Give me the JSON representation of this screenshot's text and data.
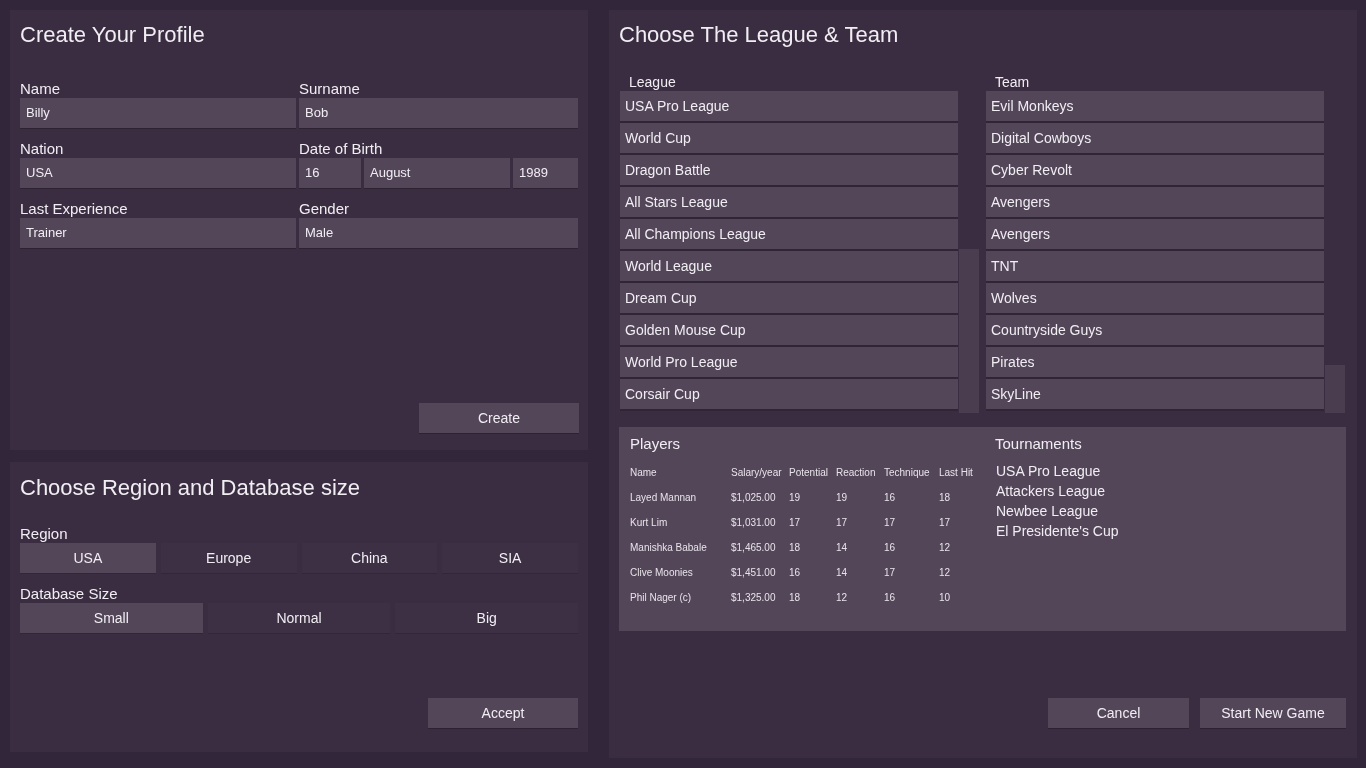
{
  "profile": {
    "title": "Create Your Profile",
    "fields": [
      {
        "label": "Name",
        "values": [
          "Billy"
        ]
      },
      {
        "label": "Surname",
        "values": [
          "Bob"
        ]
      },
      {
        "label": "Nation",
        "values": [
          "USA"
        ]
      },
      {
        "label": "Date of Birth",
        "values": [
          "16",
          "August",
          "1989"
        ]
      },
      {
        "label": "Last Experience",
        "values": [
          "Trainer"
        ]
      },
      {
        "label": "Gender",
        "values": [
          "Male"
        ]
      }
    ],
    "button": "Create"
  },
  "region_database": {
    "title": "Choose Region and Database size",
    "groups": [
      {
        "label": "Region",
        "options": [
          {
            "label": "USA",
            "selected": true
          },
          {
            "label": "Europe",
            "selected": false
          },
          {
            "label": "China",
            "selected": false
          },
          {
            "label": "SIA",
            "selected": false
          }
        ]
      },
      {
        "label": "Database Size",
        "options": [
          {
            "label": "Small",
            "selected": true
          },
          {
            "label": "Normal",
            "selected": false
          },
          {
            "label": "Big",
            "selected": false
          }
        ]
      }
    ],
    "button": "Accept"
  },
  "league_team": {
    "title": "Choose The League & Team",
    "lists": [
      {
        "header": "League",
        "items": [
          "USA Pro League",
          "World Cup",
          "Dragon Battle",
          "All Stars League",
          "All Champions League",
          "World League",
          "Dream Cup",
          "Golden Mouse Cup",
          "World Pro League",
          "Corsair Cup"
        ]
      },
      {
        "header": "Team",
        "items": [
          "Evil Monkeys",
          "Digital Cowboys",
          "Cyber Revolt",
          "Avengers",
          "Avengers",
          "TNT",
          "Wolves",
          "Countryside Guys",
          "Pirates",
          "SkyLine"
        ]
      }
    ],
    "players": {
      "title": "Players",
      "columns": [
        "Name",
        "Salary/year",
        "Potential",
        "Reaction",
        "Technique",
        "Last Hit"
      ],
      "rows": [
        [
          "Layed Mannan",
          "$1,025.00",
          "19",
          "19",
          "16",
          "18"
        ],
        [
          "Kurt Lim",
          "$1,031.00",
          "17",
          "17",
          "17",
          "17"
        ],
        [
          "Manishka Babale",
          "$1,465.00",
          "18",
          "14",
          "16",
          "12"
        ],
        [
          "Clive Moonies",
          "$1,451.00",
          "16",
          "14",
          "17",
          "12"
        ],
        [
          "Phil Nager (c)",
          "$1,325.00",
          "18",
          "12",
          "16",
          "10"
        ]
      ]
    },
    "tournaments": {
      "title": "Tournaments",
      "items": [
        "USA Pro League",
        "Attackers League",
        "Newbee League",
        "El Presidente's Cup"
      ]
    },
    "buttons": [
      "Cancel",
      "Start New Game"
    ]
  }
}
